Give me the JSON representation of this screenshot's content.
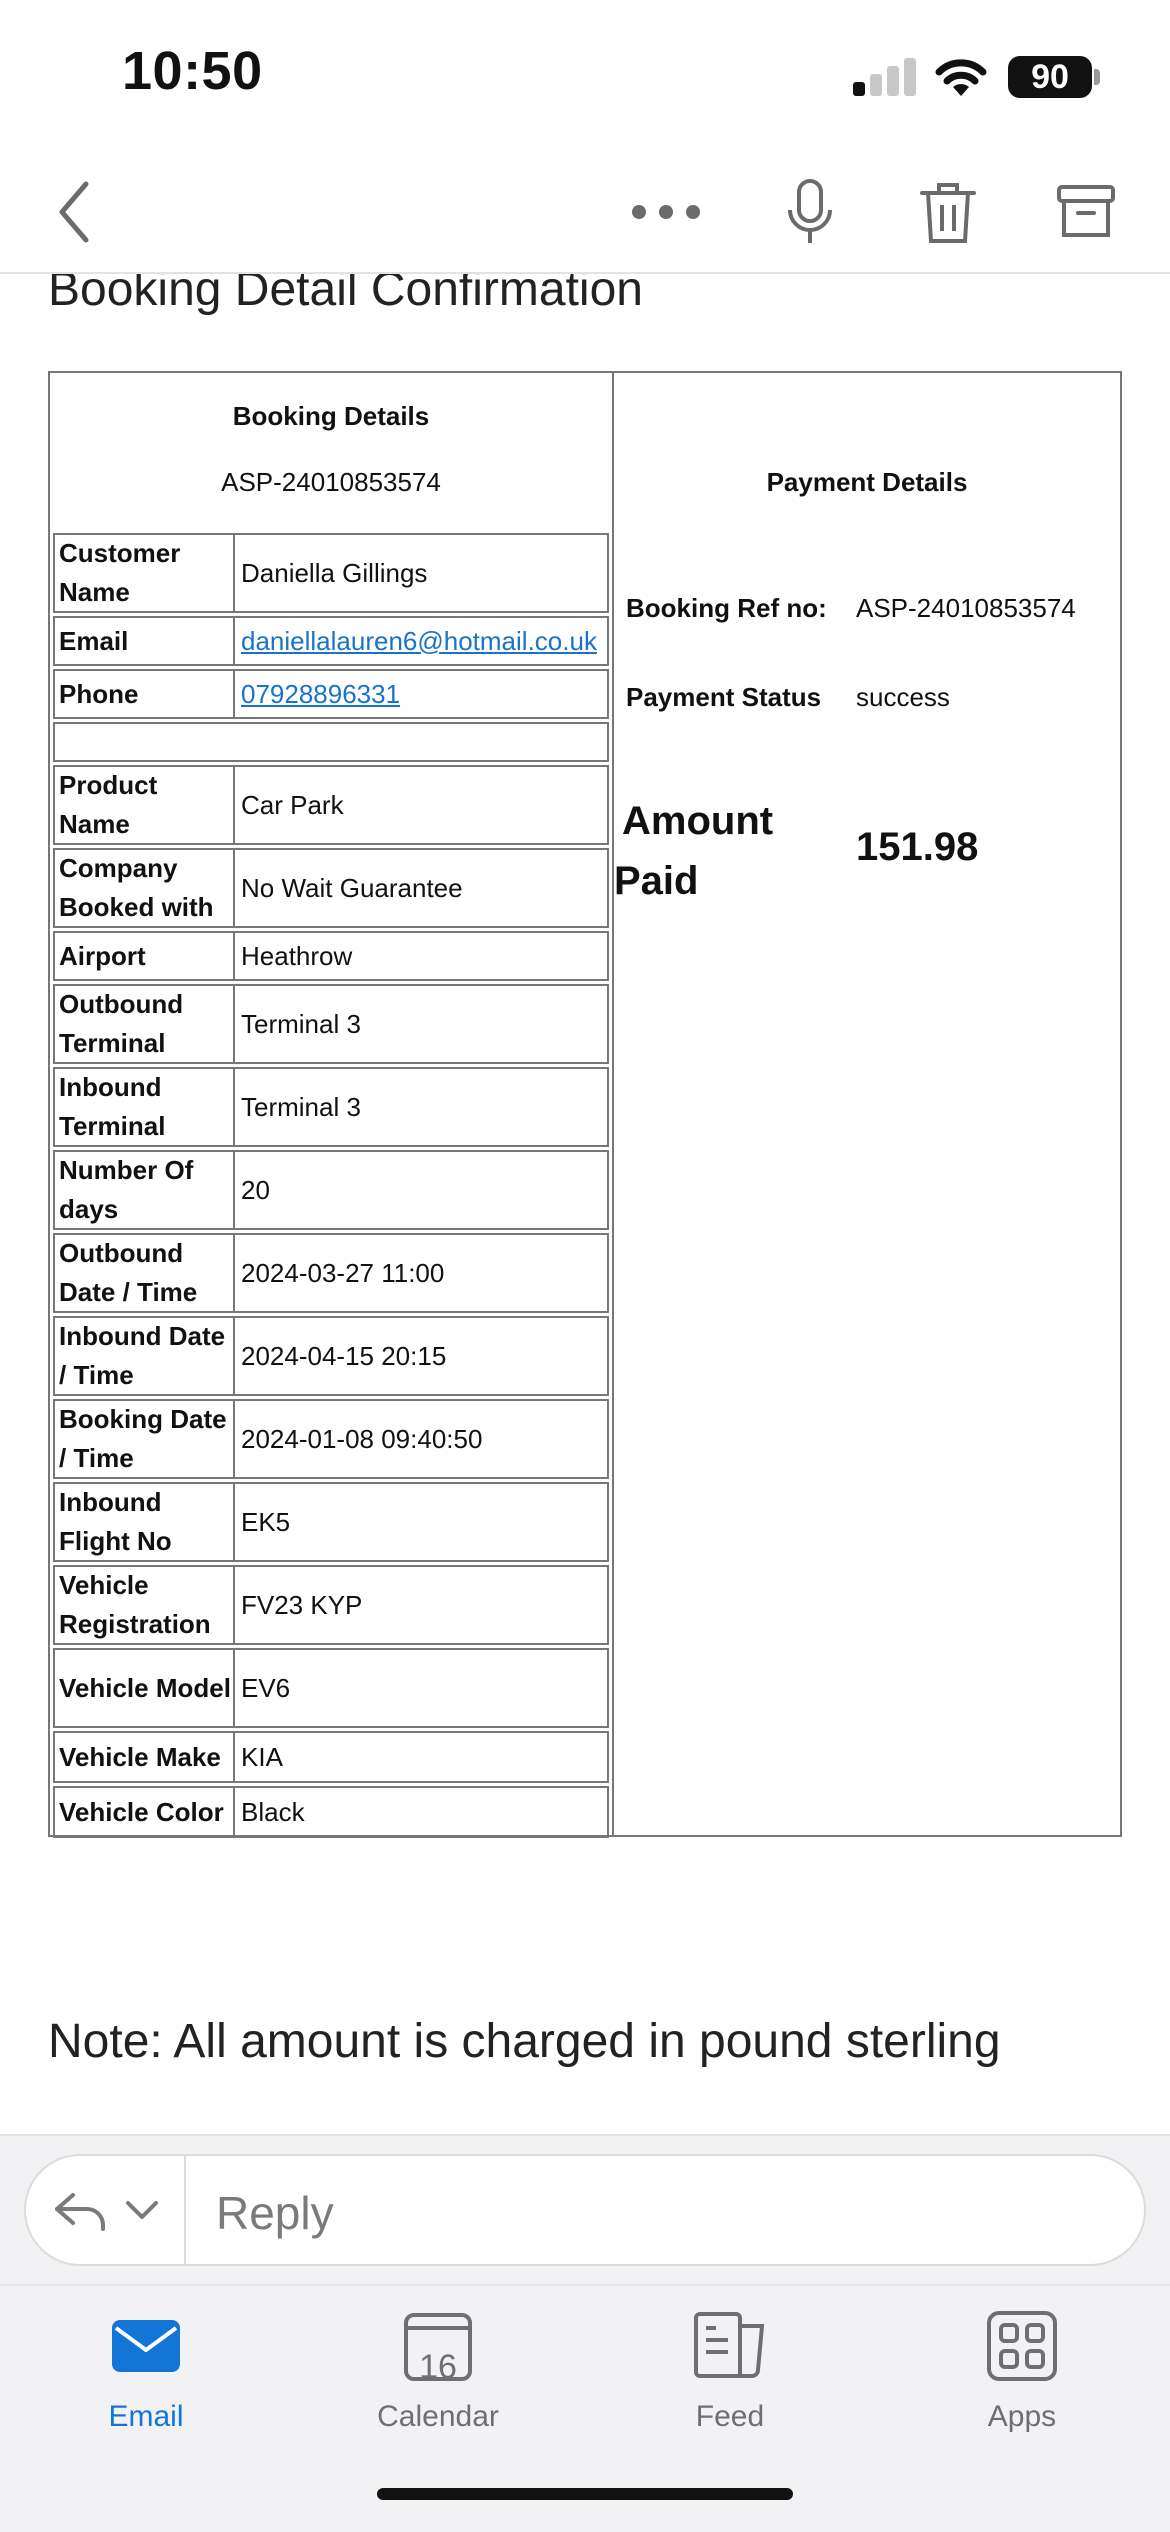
{
  "status_bar": {
    "time": "10:50",
    "battery": "90"
  },
  "page": {
    "title": "Booking Detail Confirmation"
  },
  "booking": {
    "title": "Booking Details",
    "ref": "ASP-24010853574",
    "rows": [
      {
        "label": "Customer Name",
        "value": "Daniella Gillings"
      },
      {
        "label": "Email",
        "value": "daniellalauren6@hotmail.co.uk"
      },
      {
        "label": "Phone",
        "value": "07928896331"
      },
      {
        "label": "Product Name",
        "value": "Car Park"
      },
      {
        "label": "Company Booked with",
        "value": "No Wait Guarantee"
      },
      {
        "label": "Airport",
        "value": "Heathrow"
      },
      {
        "label": "Outbound Terminal",
        "value": "Terminal 3"
      },
      {
        "label": "Inbound Terminal",
        "value": "Terminal 3"
      },
      {
        "label": "Number Of days",
        "value": "20"
      },
      {
        "label": "Outbound Date / Time",
        "value": "2024-03-27 11:00"
      },
      {
        "label": "Inbound Date / Time",
        "value": "2024-04-15 20:15"
      },
      {
        "label": "Booking Date / Time",
        "value": "2024-01-08 09:40:50"
      },
      {
        "label": "Inbound Flight No",
        "value": "EK5"
      },
      {
        "label": "Vehicle Registration",
        "value": "FV23 KYP"
      },
      {
        "label": "Vehicle Model",
        "value": "EV6"
      },
      {
        "label": "Vehicle Make",
        "value": "KIA"
      },
      {
        "label": "Vehicle Color",
        "value": "Black"
      }
    ]
  },
  "payment": {
    "title": "Payment Details",
    "ref_label": "Booking Ref no:",
    "ref_value": "ASP-24010853574",
    "status_label": "Payment Status",
    "status_value": "success",
    "amount_label_1": "Amount",
    "amount_label_2": "Paid",
    "amount_value": "151.98"
  },
  "note": "Note: All amount is charged in pound sterling",
  "reply": {
    "placeholder": "Reply"
  },
  "tabs": [
    {
      "label": "Email",
      "icon": "mail-icon",
      "calendar_day": ""
    },
    {
      "label": "Calendar",
      "icon": "calendar-icon",
      "calendar_day": "16"
    },
    {
      "label": "Feed",
      "icon": "feed-icon",
      "calendar_day": ""
    },
    {
      "label": "Apps",
      "icon": "apps-icon",
      "calendar_day": ""
    }
  ],
  "colors": {
    "accent": "#1376d6",
    "link": "#1a73c9",
    "border": "#777777"
  }
}
